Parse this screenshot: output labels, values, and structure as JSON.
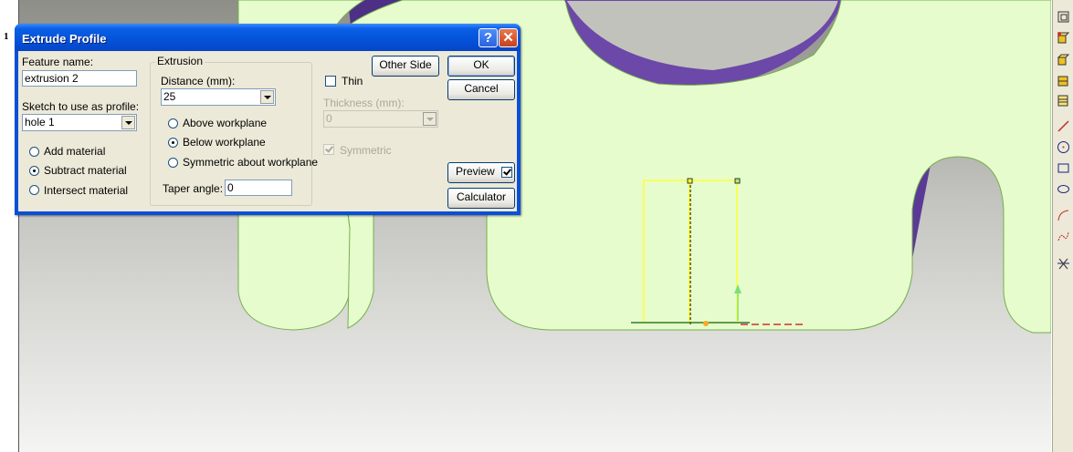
{
  "marker": "1",
  "dialog": {
    "title": "Extrude Profile",
    "feature_name_label": "Feature name:",
    "feature_name_value": "extrusion 2",
    "sketch_label": "Sketch to use as profile:",
    "sketch_value": "hole 1",
    "material_options": [
      "Add material",
      "Subtract material",
      "Intersect material"
    ],
    "material_selected": "Subtract material",
    "extrusion_group": "Extrusion",
    "distance_label": "Distance (mm):",
    "distance_value": "25",
    "direction_options": [
      "Above workplane",
      "Below workplane",
      "Symmetric about workplane"
    ],
    "direction_selected": "Below workplane",
    "taper_label": "Taper angle:",
    "taper_value": "0",
    "thin_label": "Thin",
    "thin_checked": false,
    "thickness_label": "Thickness (mm):",
    "thickness_value": "0",
    "symmetric_label": "Symmetric",
    "symmetric_checked": true,
    "other_side_label": "Other Side",
    "ok_label": "OK",
    "cancel_label": "Cancel",
    "preview_label": "Preview",
    "preview_checked": true,
    "calculator_label": "Calculator"
  },
  "colors": {
    "part_face": "#e6fccd",
    "part_side": "#6c48a8",
    "sketch": "#ffff33"
  }
}
